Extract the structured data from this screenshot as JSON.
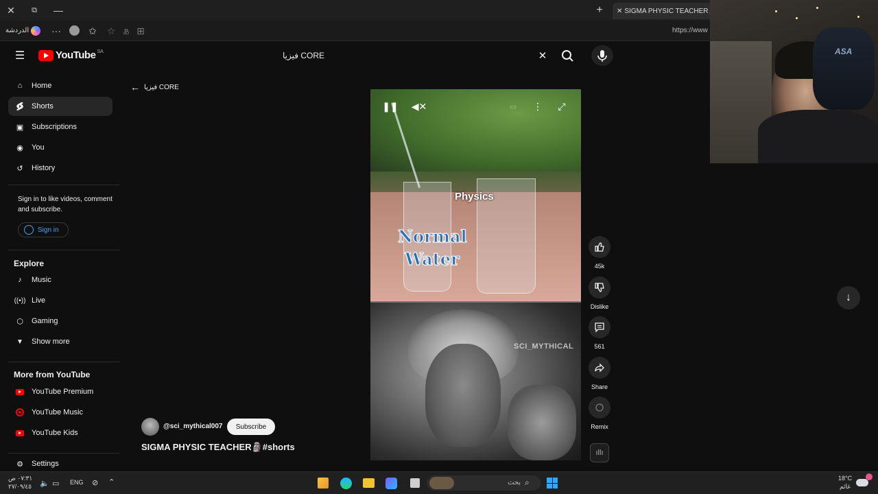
{
  "browser": {
    "active_tab_title": "SIGMA PHYSIC TEACHER🗿#sho",
    "address_text": "https://www",
    "toolbar_label": "الدردشة"
  },
  "header": {
    "logo_text": "YouTube",
    "region": "SA",
    "search_value": "فيزيا CORE"
  },
  "back": {
    "label": "فيزيا CORE"
  },
  "sidebar": {
    "items": [
      {
        "label": "Home",
        "icon": "home-icon"
      },
      {
        "label": "Shorts",
        "icon": "shorts-icon"
      },
      {
        "label": "Subscriptions",
        "icon": "subscriptions-icon"
      },
      {
        "label": "You",
        "icon": "user-icon"
      },
      {
        "label": "History",
        "icon": "history-icon"
      }
    ],
    "signin_prompt": "Sign in to like videos, comment and subscribe.",
    "signin_button": "Sign in",
    "explore_title": "Explore",
    "explore": [
      {
        "label": "Music",
        "icon": "music-icon"
      },
      {
        "label": "Live",
        "icon": "live-icon"
      },
      {
        "label": "Gaming",
        "icon": "gaming-icon"
      },
      {
        "label": "Show more",
        "icon": "chevron-down-icon"
      }
    ],
    "more_title": "More from YouTube",
    "more": [
      {
        "label": "YouTube Premium"
      },
      {
        "label": "YouTube Music"
      },
      {
        "label": "YouTube Kids"
      }
    ],
    "settings": "Settings"
  },
  "video": {
    "overlay_top": "Physics",
    "overlay_line1": "Normal",
    "overlay_line2": "Water",
    "watermark": "SCI_MYTHICAL"
  },
  "actions": {
    "like_count": "45k",
    "dislike": "Dislike",
    "comments": "561",
    "share": "Share",
    "remix": "Remix"
  },
  "channel": {
    "handle": "@sci_mythical007",
    "subscribe": "Subscribe",
    "title": "SIGMA PHYSIC TEACHER🗿#shorts"
  },
  "webcam": {
    "brand": "ASA"
  },
  "taskbar": {
    "time": "٠٧:٣١ ص",
    "date": "٢٧/٠٩/٤٥",
    "lang": "ENG",
    "search_placeholder": "بحث",
    "temp": "18°C",
    "weather": "غائم"
  }
}
